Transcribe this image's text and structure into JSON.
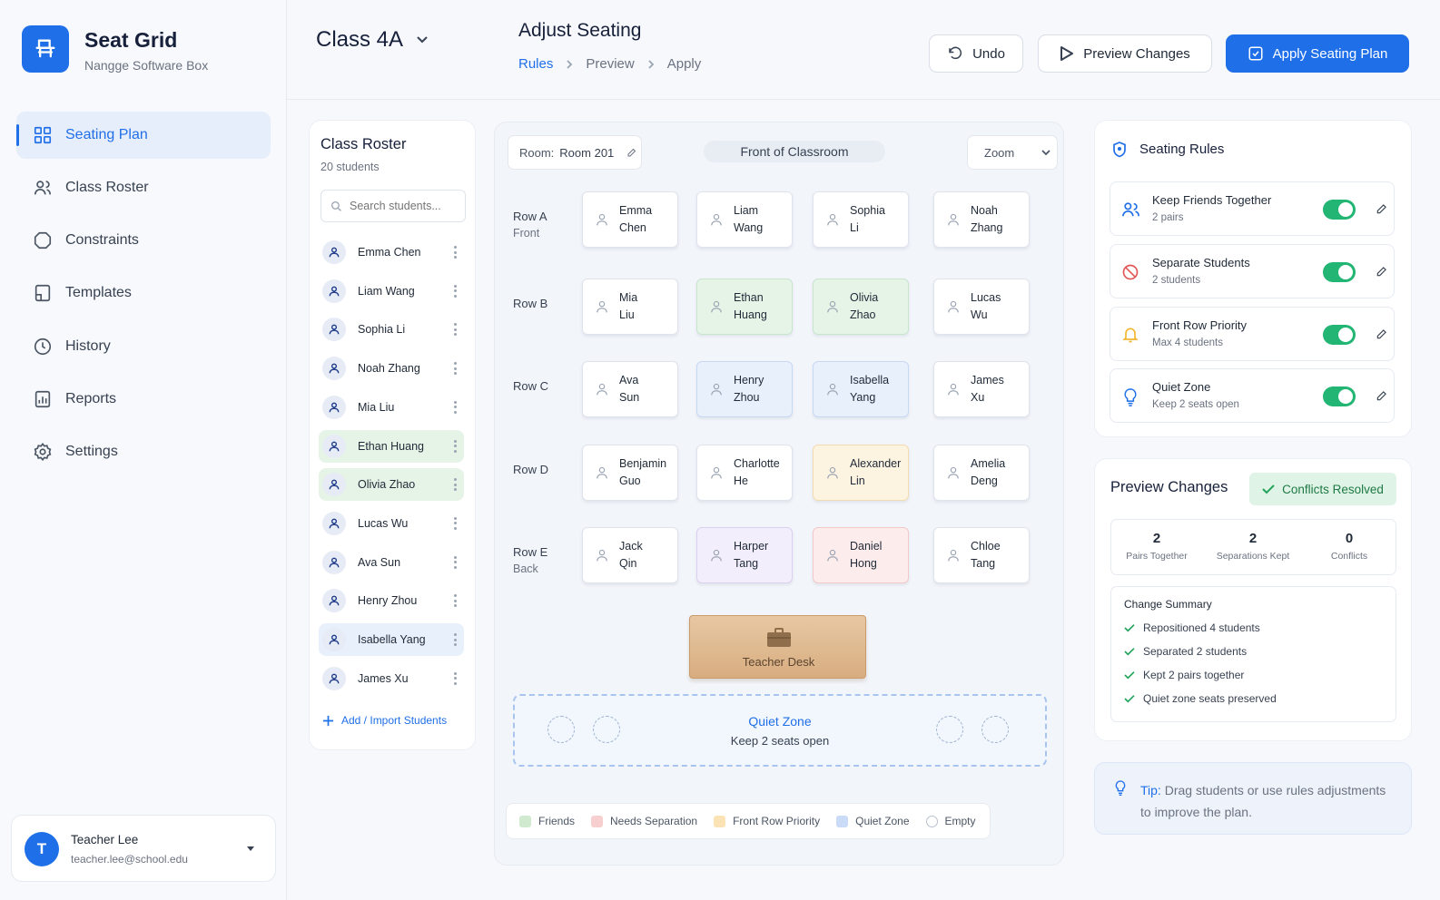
{
  "app": {
    "title": "Seat Grid",
    "subtitle": "Nangge Software Box"
  },
  "nav": [
    {
      "label": "Seating Plan",
      "icon": "grid-icon",
      "active": true
    },
    {
      "label": "Class Roster",
      "icon": "users-icon"
    },
    {
      "label": "Constraints",
      "icon": "constraints-icon"
    },
    {
      "label": "Templates",
      "icon": "template-icon"
    },
    {
      "label": "History",
      "icon": "clock-icon"
    },
    {
      "label": "Reports",
      "icon": "report-icon"
    },
    {
      "label": "Settings",
      "icon": "gear-icon"
    }
  ],
  "user": {
    "initial": "T",
    "name": "Teacher Lee",
    "email": "teacher.lee@school.edu"
  },
  "header": {
    "class_name": "Class 4A",
    "title": "Adjust Seating",
    "breadcrumb": [
      "Rules",
      "Preview",
      "Apply"
    ],
    "undo": "Undo",
    "preview": "Preview Changes",
    "apply": "Apply Seating Plan"
  },
  "roster": {
    "title": "Class Roster",
    "count": "20 students",
    "search_placeholder": "Search students...",
    "students": [
      "Emma Chen",
      "Liam Wang",
      "Sophia Li",
      "Noah Zhang",
      "Mia Liu",
      "Ethan Huang",
      "Olivia Zhao",
      "Lucas Wu",
      "Ava Sun",
      "Henry Zhou",
      "Isabella Yang",
      "James Xu"
    ],
    "add": "Add / Import Students"
  },
  "grid": {
    "room_label": "Room:",
    "room": "Room 201",
    "front": "Front of Classroom",
    "zoom": "Zoom",
    "rows": [
      {
        "label": "Row A",
        "sub": "Front",
        "seats": [
          [
            "Emma",
            "Chen"
          ],
          [
            "Liam",
            "Wang"
          ],
          [
            "Sophia",
            "Li"
          ],
          [
            "Noah",
            "Zhang"
          ]
        ]
      },
      {
        "label": "Row B",
        "sub": "",
        "seats": [
          [
            "Mia",
            "Liu"
          ],
          [
            "Ethan",
            "Huang"
          ],
          [
            "Olivia",
            "Zhao"
          ],
          [
            "Lucas",
            "Wu"
          ]
        ]
      },
      {
        "label": "Row C",
        "sub": "",
        "seats": [
          [
            "Ava",
            "Sun"
          ],
          [
            "Henry",
            "Zhou"
          ],
          [
            "Isabella",
            "Yang"
          ],
          [
            "James",
            "Xu"
          ]
        ]
      },
      {
        "label": "Row D",
        "sub": "",
        "seats": [
          [
            "Benjamin",
            "Guo"
          ],
          [
            "Charlotte",
            "He"
          ],
          [
            "Alexander",
            "Lin"
          ],
          [
            "Amelia",
            "Deng"
          ]
        ]
      },
      {
        "label": "Row E",
        "sub": "Back",
        "seats": [
          [
            "Jack",
            "Qin"
          ],
          [
            "Harper",
            "Tang"
          ],
          [
            "Daniel",
            "Hong"
          ],
          [
            "Chloe",
            "Tang"
          ]
        ]
      }
    ],
    "teacher_desk": "Teacher Desk",
    "quiet_title": "Quiet Zone",
    "quiet_sub": "Keep 2 seats open",
    "legend": [
      "Friends",
      "Needs Separation",
      "Front Row Priority",
      "Quiet Zone",
      "Empty"
    ]
  },
  "rules": {
    "title": "Seating Rules",
    "items": [
      {
        "title": "Keep Friends Together",
        "sub": "2 pairs",
        "on": true
      },
      {
        "title": "Separate Students",
        "sub": "2 students",
        "on": true
      },
      {
        "title": "Front Row Priority",
        "sub": "Max 4 students",
        "on": true
      },
      {
        "title": "Quiet Zone",
        "sub": "Keep 2 seats open",
        "on": true
      }
    ]
  },
  "preview": {
    "title": "Preview Changes",
    "badge": "Conflicts Resolved",
    "stats": [
      {
        "value": "2",
        "label": "Pairs Together"
      },
      {
        "value": "2",
        "label": "Separations Kept"
      },
      {
        "value": "0",
        "label": "Conflicts"
      }
    ],
    "summary_title": "Change Summary",
    "summary": [
      "Repositioned 4 students",
      "Separated 2 students",
      "Kept 2 pairs together",
      "Quiet zone seats preserved"
    ]
  },
  "tip": {
    "label": "Tip:",
    "text": "Drag students or use rules adjustments to improve the plan."
  },
  "colors": {
    "accent": "#1f6fe8",
    "friends": "#e6f4e7",
    "separation": "#fdecec",
    "front_priority": "#fdf3e1",
    "quiet": "#e8f0fb",
    "toggle_on": "#22b573"
  }
}
